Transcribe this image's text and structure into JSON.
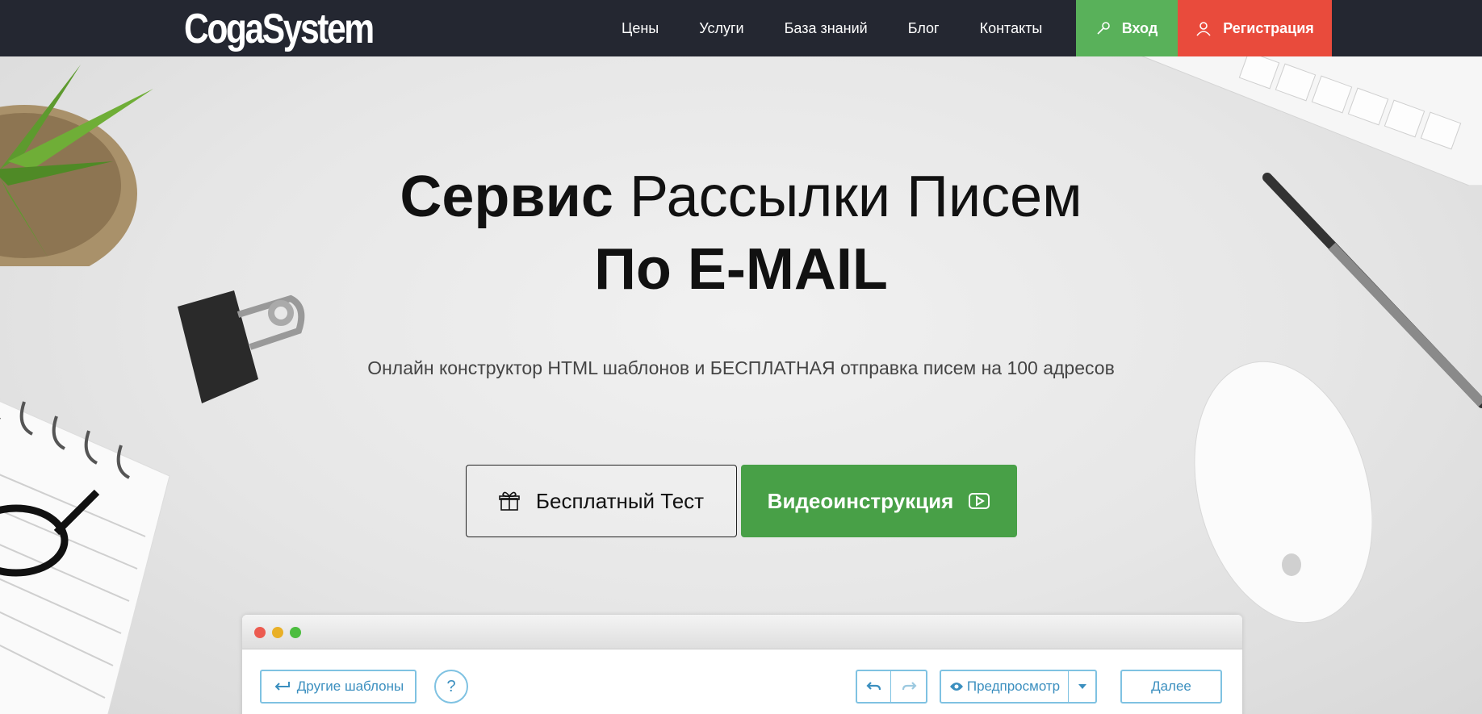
{
  "nav": {
    "logo": "CogaSystem",
    "links": [
      "Цены",
      "Услуги",
      "База знаний",
      "Блог",
      "Контакты"
    ],
    "login_label": "Вход",
    "register_label": "Регистрация",
    "colors": {
      "bar": "#242731",
      "login": "#59b15a",
      "register": "#e94b3c"
    }
  },
  "hero": {
    "title_bold": "Сервис",
    "title_light": "Рассылки Писем",
    "title_line2": "По E-MAIL",
    "subtitle": "Онлайн конструктор HTML шаблонов и БЕСПЛАТНАЯ отправка писем на 100 адресов"
  },
  "cta": {
    "free_test_label": "Бесплатный Тест",
    "video_label": "Видеоинструкция",
    "video_color": "#48a047"
  },
  "editor": {
    "other_templates_label": "Другие шаблоны",
    "help_label": "?",
    "preview_label": "Предпросмотр",
    "next_label": "Далее"
  },
  "icons": {
    "login": "key-icon",
    "register": "user-icon",
    "free_test": "gift-icon",
    "video": "play-icon",
    "other_templates": "back-arrow-icon",
    "undo": "undo-icon",
    "redo": "redo-icon",
    "preview": "eye-icon",
    "dropdown": "caret-down-icon"
  }
}
